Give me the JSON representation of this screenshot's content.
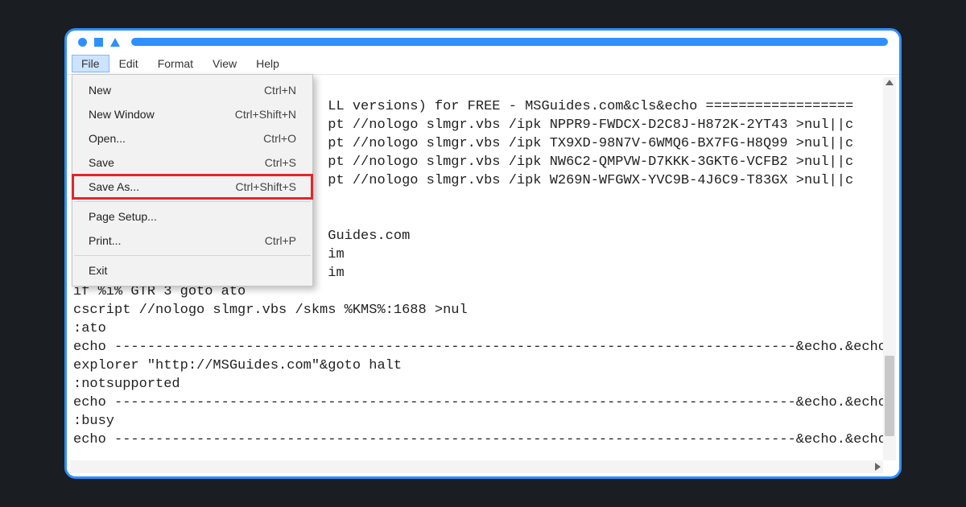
{
  "menubar": {
    "items": [
      {
        "label": "File",
        "active": true
      },
      {
        "label": "Edit",
        "active": false
      },
      {
        "label": "Format",
        "active": false
      },
      {
        "label": "View",
        "active": false
      },
      {
        "label": "Help",
        "active": false
      }
    ]
  },
  "dropdown": {
    "items": [
      {
        "label": "New",
        "shortcut": "Ctrl+N",
        "sep": false,
        "highlight": false
      },
      {
        "label": "New Window",
        "shortcut": "Ctrl+Shift+N",
        "sep": false,
        "highlight": false
      },
      {
        "label": "Open...",
        "shortcut": "Ctrl+O",
        "sep": false,
        "highlight": false
      },
      {
        "label": "Save",
        "shortcut": "Ctrl+S",
        "sep": false,
        "highlight": false
      },
      {
        "label": "Save As...",
        "shortcut": "Ctrl+Shift+S",
        "sep": false,
        "highlight": true
      },
      {
        "sep": true
      },
      {
        "label": "Page Setup...",
        "shortcut": "",
        "sep": false,
        "highlight": false
      },
      {
        "label": "Print...",
        "shortcut": "Ctrl+P",
        "sep": false,
        "highlight": false
      },
      {
        "sep": true
      },
      {
        "label": "Exit",
        "shortcut": "",
        "sep": false,
        "highlight": false
      }
    ]
  },
  "editor": {
    "lines": [
      "",
      "                               LL versions) for FREE - MSGuides.com&cls&echo ==================",
      "                               pt //nologo slmgr.vbs /ipk NPPR9-FWDCX-D2C8J-H872K-2YT43 >nul||c",
      "                               pt //nologo slmgr.vbs /ipk TX9XD-98N7V-6WMQ6-BX7FG-H8Q99 >nul||c",
      "                               pt //nologo slmgr.vbs /ipk NW6C2-QMPVW-D7KKK-3GKT6-VCFB2 >nul||c",
      "                               pt //nologo slmgr.vbs /ipk W269N-WFGWX-YVC9B-4J6C9-T83GX >nul||c",
      "",
      "",
      "                               Guides.com",
      "                               im",
      "                               im",
      "if %i% GTR 3 goto ato",
      "cscript //nologo slmgr.vbs /skms %KMS%:1688 >nul",
      ":ato",
      "echo -----------------------------------------------------------------------------------&echo.&echo",
      "explorer \"http://MSGuides.com\"&goto halt",
      ":notsupported",
      "echo -----------------------------------------------------------------------------------&echo.&echo",
      ":busy",
      "echo -----------------------------------------------------------------------------------&echo.&echo"
    ]
  }
}
